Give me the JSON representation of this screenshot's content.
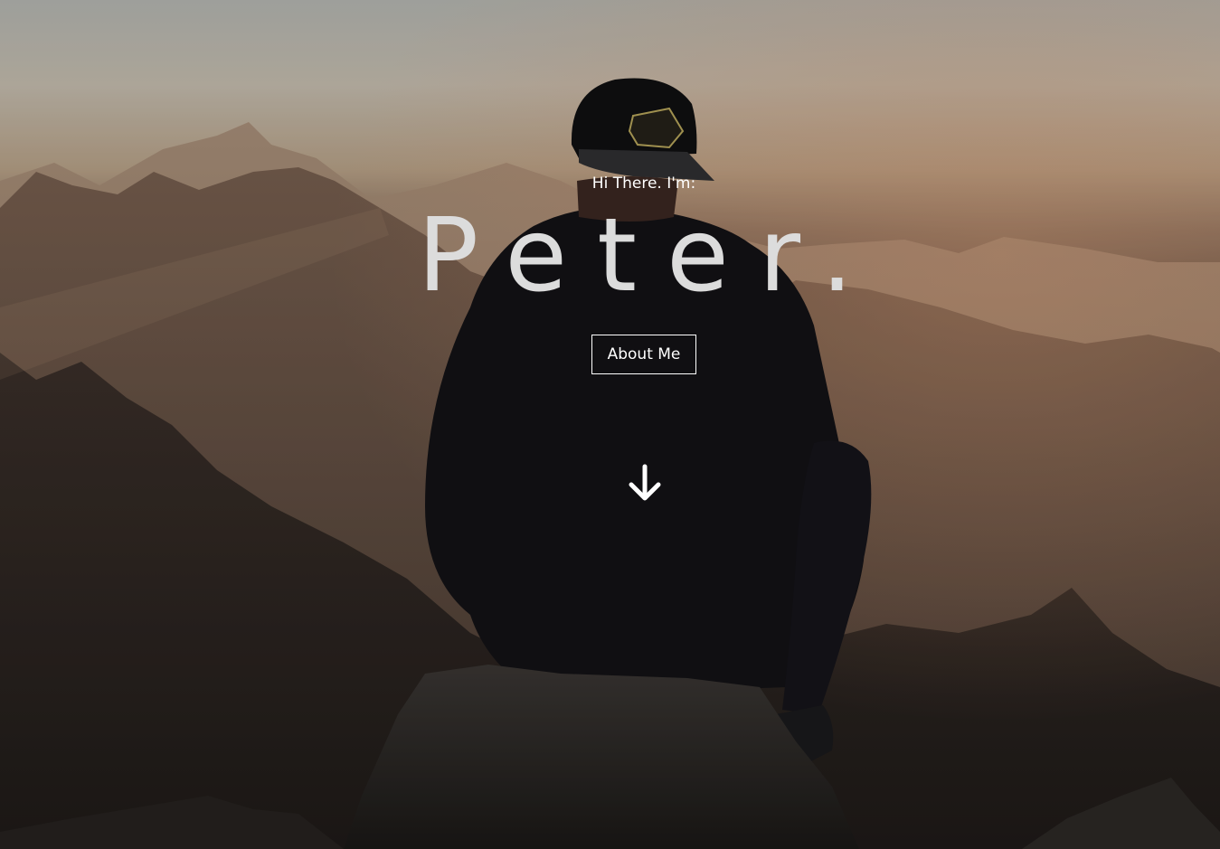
{
  "hero": {
    "greeting": "Hi There. I'm:",
    "name": "Peter.",
    "about_button_label": "About Me",
    "scroll_icon": "arrow-down-icon"
  },
  "colors": {
    "text": "#ffffff",
    "name_text": "#dcdcdc"
  }
}
